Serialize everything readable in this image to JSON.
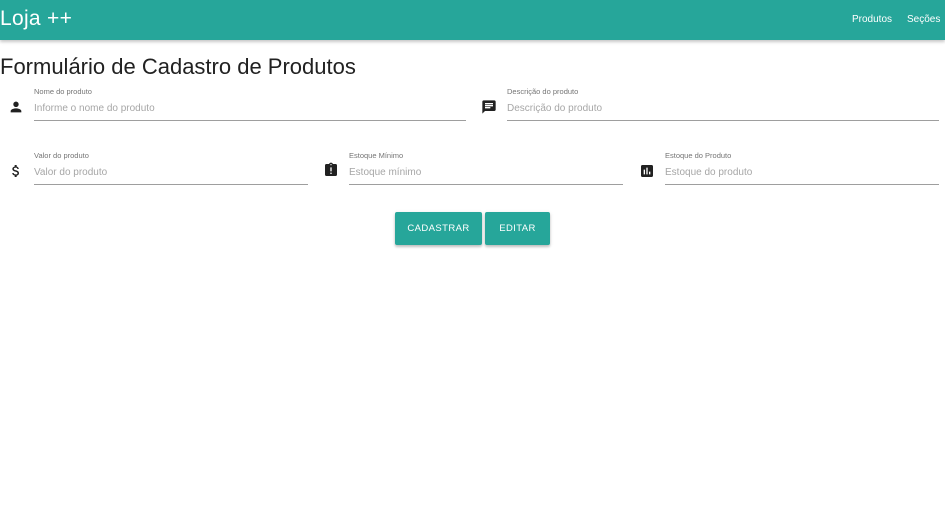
{
  "navbar": {
    "brand": "Loja ++",
    "links": [
      {
        "label": "Produtos"
      },
      {
        "label": "Seções"
      }
    ],
    "color": "#26a69a"
  },
  "form": {
    "title": "Formulário de Cadastro de Produtos",
    "fields": {
      "nome": {
        "label": "Nome do produto",
        "placeholder": "Informe o nome do produto",
        "value": "",
        "icon": "person-icon"
      },
      "descricao": {
        "label": "Descrição do produto",
        "placeholder": "Descrição do produto",
        "value": "",
        "icon": "comment-icon"
      },
      "valor": {
        "label": "Valor do produto",
        "placeholder": "Valor do produto",
        "value": "",
        "icon": "dollar-icon"
      },
      "estoque_minimo": {
        "label": "Estoque Mínimo",
        "placeholder": "Estoque mínimo",
        "value": "",
        "icon": "assignment-late-icon"
      },
      "estoque_produto": {
        "label": "Estoque do Produto",
        "placeholder": "Estoque do produto",
        "value": "",
        "icon": "bar-chart-icon"
      }
    },
    "buttons": {
      "cadastrar": "CADASTRAR",
      "editar": "EDITAR"
    }
  }
}
